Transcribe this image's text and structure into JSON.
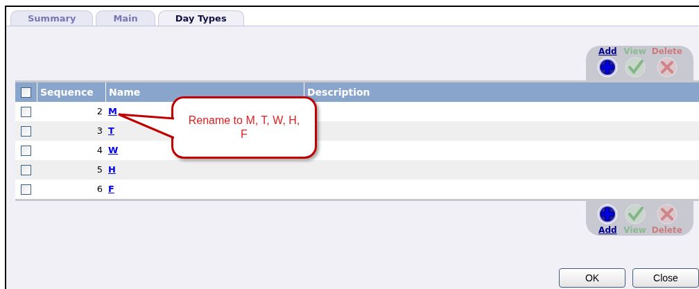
{
  "tabs": [
    {
      "label": "Summary",
      "selected": false
    },
    {
      "label": "Main",
      "selected": false
    },
    {
      "label": "Day Types",
      "selected": true
    }
  ],
  "top_actions": [
    {
      "kind": "add",
      "label": "Add",
      "disabled": false
    },
    {
      "kind": "view",
      "label": "View",
      "disabled": true
    },
    {
      "kind": "delete",
      "label": "Delete",
      "disabled": true
    }
  ],
  "table": {
    "select_all_checked": false,
    "columns": [
      "Sequence",
      "Name",
      "Description"
    ],
    "rows": [
      {
        "checked": false,
        "sequence": "2",
        "name": "M"
      },
      {
        "checked": false,
        "sequence": "3",
        "name": "T"
      },
      {
        "checked": false,
        "sequence": "4",
        "name": "W"
      },
      {
        "checked": false,
        "sequence": "5",
        "name": "H"
      },
      {
        "checked": false,
        "sequence": "6",
        "name": "F"
      }
    ]
  },
  "callout": {
    "text": "Rename to M, T, W, H, F"
  },
  "bottom_actions": [
    {
      "kind": "add",
      "label": "Add",
      "disabled": false
    },
    {
      "kind": "view",
      "label": "View",
      "disabled": true
    },
    {
      "kind": "delete",
      "label": "Delete",
      "disabled": true
    }
  ],
  "buttons": [
    "OK",
    "Close"
  ]
}
